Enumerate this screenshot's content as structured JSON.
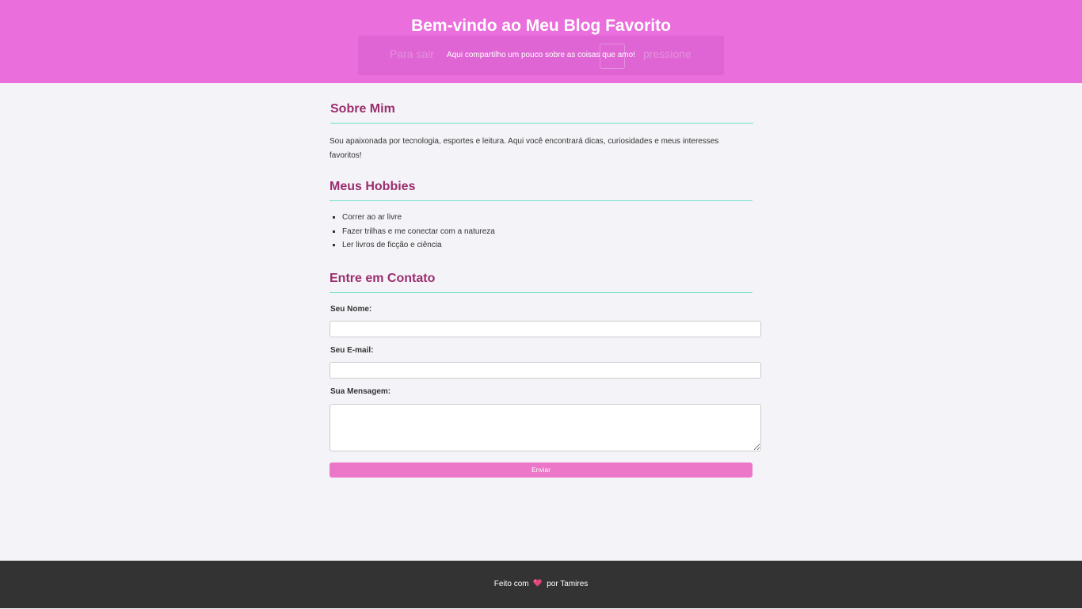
{
  "header": {
    "title": "Bem-vindo ao Meu Blog Favorito",
    "subtitle": "Aqui compartilho um pouco sobre as coisas que amo!",
    "background": "#ea6edc",
    "overlay": {
      "text_left": "Para sair",
      "text_right": "pressione"
    }
  },
  "about": {
    "title": "Sobre Mim",
    "text": "Sou apaixonada por tecnologia, esportes e leitura. Aqui você encontrará dicas, curiosidades e meus interesses favoritos!"
  },
  "hobbies": {
    "title": "Meus Hobbies",
    "items": [
      "Correr ao ar livre",
      "Fazer trilhas e me conectar com a natureza",
      "Ler livros de ficção e ciência"
    ]
  },
  "contact": {
    "title": "Entre em Contato",
    "name_label": "Seu Nome:",
    "name_value": "",
    "email_label": "Seu E-mail:",
    "email_value": "",
    "message_label": "Sua Mensagem:",
    "message_value": "",
    "submit_label": "Enviar",
    "button_color": "#ec76c8"
  },
  "footer": {
    "prefix": "Feito com",
    "icon": "heart-icon",
    "suffix": "por Tamires",
    "background": "#333333"
  },
  "colors": {
    "accent": "#9b2d6e",
    "divider": "#6fe0c8",
    "page_bg": "#f4f4f8"
  }
}
